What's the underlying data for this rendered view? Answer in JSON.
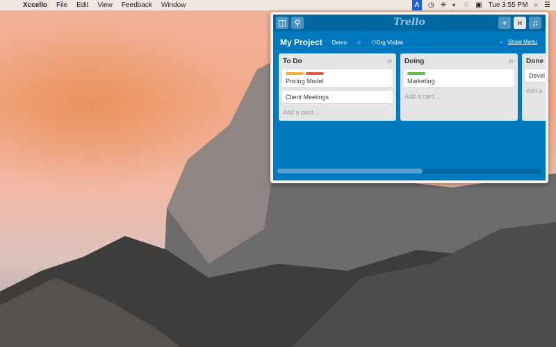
{
  "menubar": {
    "app": "Xccello",
    "items": [
      "File",
      "Edit",
      "View",
      "Feedback",
      "Window"
    ],
    "clock": "Tue 3:55 PM"
  },
  "trello": {
    "logo": "Trello",
    "avatar": "H",
    "add": "+",
    "board": {
      "title": "My Project",
      "team": "Demo",
      "visibility": "Org Visible",
      "show_menu": "Show Menu"
    },
    "lists": [
      {
        "title": "To Do",
        "cards": [
          {
            "title": "Pricing Model",
            "labels": [
              "#f6ad41",
              "#eb5a46"
            ]
          },
          {
            "title": "Client Meetings",
            "labels": []
          }
        ],
        "add": "Add a card…"
      },
      {
        "title": "Doing",
        "cards": [
          {
            "title": "Marketing",
            "labels": [
              "#61bd4f"
            ]
          }
        ],
        "add": "Add a card…"
      },
      {
        "title": "Done",
        "cards": [
          {
            "title": "Devel",
            "labels": []
          }
        ],
        "add": "Add a"
      }
    ]
  }
}
